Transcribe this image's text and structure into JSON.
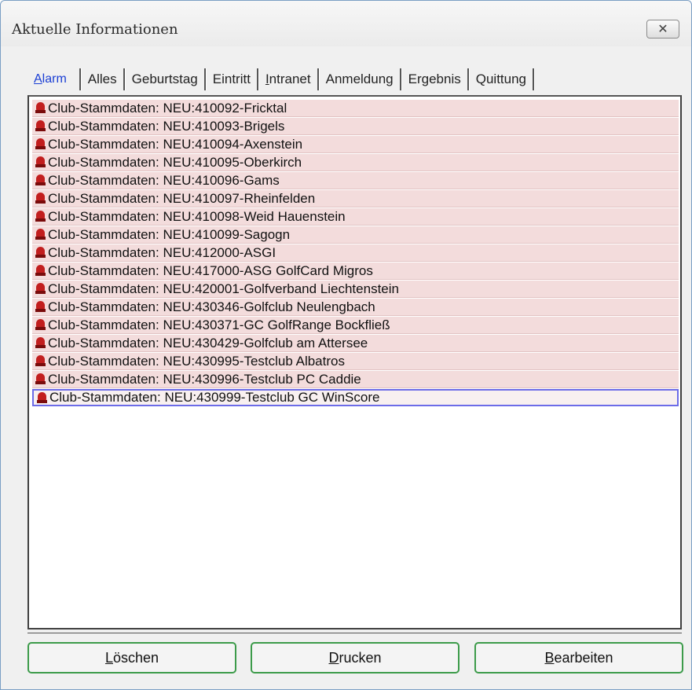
{
  "window": {
    "title": "Aktuelle Informationen"
  },
  "tabs": [
    {
      "first": "A",
      "rest": "larm"
    },
    {
      "first": "",
      "rest": "Alles"
    },
    {
      "first": "",
      "rest": "Geburtstag"
    },
    {
      "first": "",
      "rest": "Eintritt"
    },
    {
      "first": "I",
      "rest": "ntranet"
    },
    {
      "first": "",
      "rest": "Anmeldung"
    },
    {
      "first": "",
      "rest": "Ergebnis"
    },
    {
      "first": "",
      "rest": "Quittung"
    }
  ],
  "alarms": [
    "Club-Stammdaten: NEU:410092-Fricktal",
    "Club-Stammdaten: NEU:410093-Brigels",
    "Club-Stammdaten: NEU:410094-Axenstein",
    "Club-Stammdaten: NEU:410095-Oberkirch",
    "Club-Stammdaten: NEU:410096-Gams",
    "Club-Stammdaten: NEU:410097-Rheinfelden",
    "Club-Stammdaten: NEU:410098-Weid Hauenstein",
    "Club-Stammdaten: NEU:410099-Sagogn",
    "Club-Stammdaten: NEU:412000-ASGI",
    "Club-Stammdaten: NEU:417000-ASG GolfCard Migros",
    "Club-Stammdaten: NEU:420001-Golfverband Liechtenstein",
    "Club-Stammdaten: NEU:430346-Golfclub Neulengbach",
    "Club-Stammdaten: NEU:430371-GC GolfRange Bockfließ",
    "Club-Stammdaten: NEU:430429-Golfclub am Attersee",
    "Club-Stammdaten: NEU:430995-Testclub Albatros",
    "Club-Stammdaten: NEU:430996-Testclub PC Caddie",
    "Club-Stammdaten: NEU:430999-Testclub GC WinScore"
  ],
  "selected_index": 16,
  "buttons": {
    "delete": {
      "first": "L",
      "rest": "öschen"
    },
    "print": {
      "first": "D",
      "rest": "rucken"
    },
    "edit": {
      "first": "B",
      "rest": "earbeiten"
    }
  },
  "colors": {
    "row_bg": "#f3dcdc",
    "selection_border": "#6c6ce8",
    "button_border": "#3c9b4a",
    "active_tab": "#1a3ed4"
  }
}
